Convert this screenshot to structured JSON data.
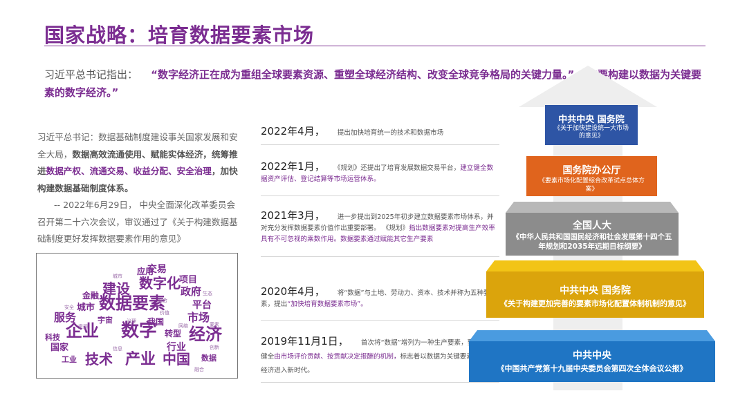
{
  "header": {
    "title": "国家战略：培育数据要素市场"
  },
  "quote": {
    "speaker": "习近平总书记指出：",
    "q1": "“数字经济正在成为重组全球要素资源、重塑全球经济结构、改变全球竞争格局的关键力量。”",
    "q2": "“要构建以数据为关键要素的数字经济。”"
  },
  "left": {
    "p1_a": "习近平总书记：数据基础制度建设事关国家发展和安全大局，",
    "p1_b": "数据高效流通使用、赋能实体经济，统筹推进",
    "p1_c": "数据产权、流通交易、收益分配、安全治理",
    "p1_d": "，加快构建数据基础制度体系。",
    "p2": "-- 2022年6月29日， 中央全面深化改革委员会召开第二十六次会议，审议通过了《关于构建数据基础制度更好发挥数据要素作用的意见》"
  },
  "wordcloud": {
    "words": [
      "数字",
      "数据要素",
      "经济",
      "发展",
      "企业",
      "产业",
      "中国",
      "技术",
      "建设",
      "数字化",
      "服务",
      "市场",
      "政府",
      "交易",
      "应用",
      "项目",
      "城市",
      "金融",
      "平台",
      "行业",
      "我国",
      "转型",
      "科技",
      "国家",
      "工业",
      "宇宙",
      "数据",
      "资源",
      "要素",
      "价值",
      "网络",
      "信息",
      "创新",
      "安全",
      "治理",
      "生态",
      "城市",
      "融合"
    ]
  },
  "timeline": [
    {
      "date": "2022年4月，",
      "text": "提出加快培育统一的技术和数据市场",
      "purple": ""
    },
    {
      "date": "2022年1月，",
      "text": "《规划》还提出了培育发展数据交易平台，",
      "purple": "建立健全数据资产评估、登记结算等市场运营体系。"
    },
    {
      "date": "2021年3月，",
      "text": "进一步提出到2025年初步建立数据要素市场体系，并对充分发挥数据要素价值作出重要部署。 《规划》",
      "purple": "指出数据要素对提高生产效率具有不可忽视的乘数作用。数据要素通过赋能其它生产要素"
    },
    {
      "date": "2020年4月，",
      "text": "将“数据”与土地、劳动力、资本、技术并称为五种要素，提出",
      "purple": "“加快培育数据要素市场”。"
    },
    {
      "date": "2019年11月1日，",
      "text": "首次将“数据”增列为一种生产要素，要求建立健全",
      "purple": "由市场评价贡献、按贡献决定报酬的机制，",
      "text2": "标志着以数据为关键要素的数字经济进入新时代。"
    }
  ],
  "pyramid": [
    {
      "org": "中共中央 国务院",
      "doc": "《关于加快建设统一大市场的意见》",
      "color": "#2e55a5"
    },
    {
      "org": "国务院办公厅",
      "doc": "《要素市场化配置综合改革试点总体方案》",
      "color": "#e0641d"
    },
    {
      "org": "全国人大",
      "doc": "《中华人民共和国国民经济和社会发展第十四个五年规划和2035年远期目标纲要》",
      "color": "#8c8c8c"
    },
    {
      "org": "中共中央  国务院",
      "doc": "《关于构建更加完善的要素市场化配置体制机制的意见》",
      "color": "#dba40c"
    },
    {
      "org": "中共中央",
      "doc": "《中国共产党第十九届中央委员会第四次全体会议公报》",
      "color": "#1f75c4"
    }
  ]
}
